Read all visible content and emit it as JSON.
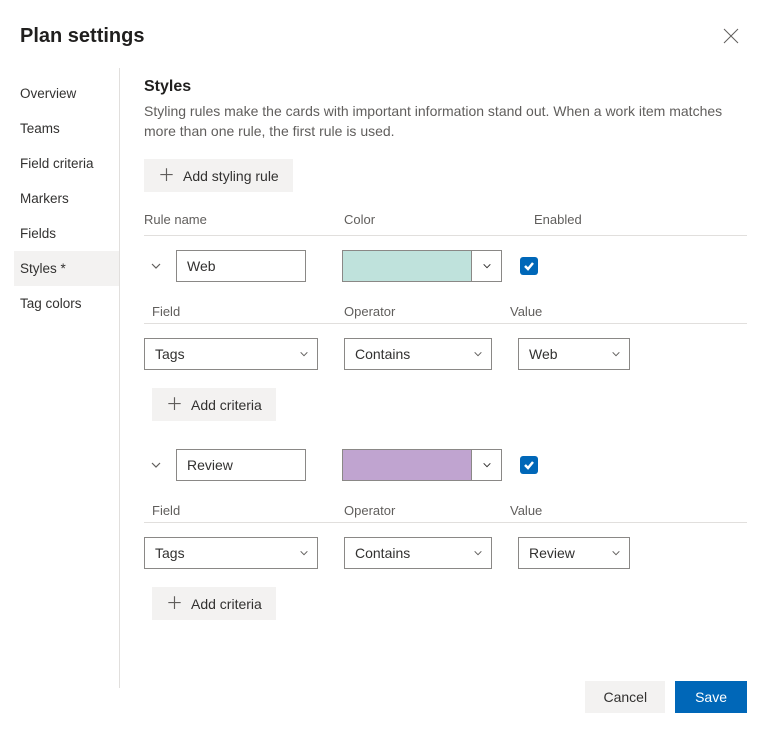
{
  "header": {
    "title": "Plan settings"
  },
  "sidebar": {
    "items": [
      {
        "label": "Overview"
      },
      {
        "label": "Teams"
      },
      {
        "label": "Field criteria"
      },
      {
        "label": "Markers"
      },
      {
        "label": "Fields"
      },
      {
        "label": "Styles *"
      },
      {
        "label": "Tag colors"
      }
    ]
  },
  "main": {
    "title": "Styles",
    "description": "Styling rules make the cards with important information stand out. When a work item matches more than one rule, the first rule is used.",
    "add_rule_label": "Add styling rule",
    "cols": {
      "rule_name": "Rule name",
      "color": "Color",
      "enabled": "Enabled"
    },
    "criteria_cols": {
      "field": "Field",
      "operator": "Operator",
      "value": "Value"
    },
    "add_criteria_label": "Add criteria",
    "rules": [
      {
        "name": "Web",
        "color": "#bfe2dc",
        "enabled": true,
        "criteria": [
          {
            "field": "Tags",
            "operator": "Contains",
            "value": "Web"
          }
        ]
      },
      {
        "name": "Review",
        "color": "#c0a4d0",
        "enabled": true,
        "criteria": [
          {
            "field": "Tags",
            "operator": "Contains",
            "value": "Review"
          }
        ]
      }
    ]
  },
  "footer": {
    "cancel": "Cancel",
    "save": "Save"
  }
}
